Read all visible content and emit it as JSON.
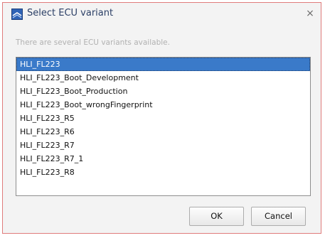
{
  "dialog": {
    "title": "Select ECU variant",
    "close_label": "×",
    "message": "There are several ECU variants available."
  },
  "variants": {
    "selected_index": 0,
    "items": [
      "HLI_FL223",
      "HLI_FL223_Boot_Development",
      "HLI_FL223_Boot_Production",
      "HLI_FL223_Boot_wrongFingerprint",
      "HLI_FL223_R5",
      "HLI_FL223_R6",
      "HLI_FL223_R7",
      "HLI_FL223_R7_1",
      "HLI_FL223_R8"
    ]
  },
  "buttons": {
    "ok_label": "OK",
    "cancel_label": "Cancel"
  },
  "colors": {
    "window_border": "#e07b7b",
    "selection": "#3a7ac9",
    "title_text": "#2b3f66",
    "icon_blue": "#2f63b6"
  },
  "icons": {
    "title_icon": "ecu-app-icon",
    "close_icon": "close-icon"
  }
}
